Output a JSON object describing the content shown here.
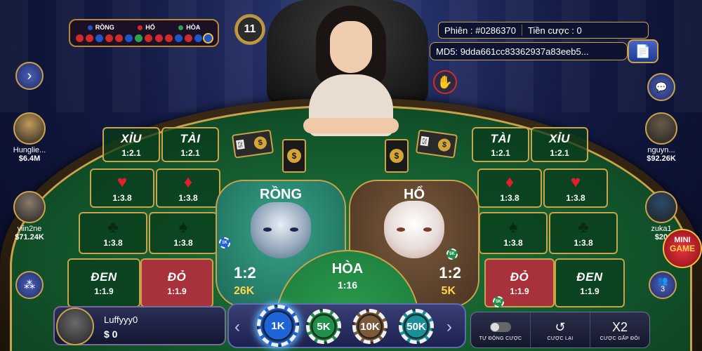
{
  "history": {
    "legend": [
      {
        "label": "RỒNG",
        "color": "#1e56c9"
      },
      {
        "label": "HỔ",
        "color": "#d12a2a"
      },
      {
        "label": "HÒA",
        "color": "#2aa34a"
      }
    ],
    "dots": [
      "#d12a2a",
      "#d12a2a",
      "#1e56c9",
      "#d12a2a",
      "#d12a2a",
      "#1e56c9",
      "#2aa34a",
      "#d12a2a",
      "#d12a2a",
      "#d12a2a",
      "#1e56c9",
      "#d12a2a",
      "#1e56c9",
      "#1e56c9"
    ]
  },
  "round_timer": "11",
  "session": {
    "phien_label": "Phiên :",
    "phien_value": "#0286370",
    "tien_label": "Tiền cược :",
    "tien_value": "0",
    "md5_label": "MD5:",
    "md5_value": "9dda661cc83362937a83eeb5..."
  },
  "players_left": [
    {
      "name": "Hunglie...",
      "amount": "$6.4M",
      "avatar_color": "#c49a5a"
    },
    {
      "name": "viin2ne",
      "amount": "$71.24K",
      "avatar_color": "#8a7a6a"
    }
  ],
  "players_right": [
    {
      "name": "nguyn...",
      "amount": "$92.26K",
      "avatar_color": "#6a5a4a"
    },
    {
      "name": "zuka1",
      "amount": "$20",
      "avatar_color": "#2a4a6a"
    }
  ],
  "left_cells": {
    "xiu": {
      "label": "XỈU",
      "odds": "1:2.1"
    },
    "tai": {
      "label": "TÀI",
      "odds": "1:2.1"
    },
    "heart": {
      "symbol": "♥",
      "odds": "1:3.8"
    },
    "diamond": {
      "symbol": "♦",
      "odds": "1:3.8"
    },
    "club": {
      "symbol": "♣",
      "odds": "1:3.8"
    },
    "spade": {
      "symbol": "♠",
      "odds": "1:3.8"
    },
    "den": {
      "label": "ĐEN",
      "odds": "1:1.9"
    },
    "do": {
      "label": "ĐỎ",
      "odds": "1:1.9"
    }
  },
  "right_cells": {
    "tai": {
      "label": "TÀI",
      "odds": "1:2.1"
    },
    "xiu": {
      "label": "XỈU",
      "odds": "1:2.1"
    },
    "diamond": {
      "symbol": "♦",
      "odds": "1:3.8"
    },
    "heart": {
      "symbol": "♥",
      "odds": "1:3.8"
    },
    "spade": {
      "symbol": "♠",
      "odds": "1:3.8"
    },
    "club": {
      "symbol": "♣",
      "odds": "1:3.8"
    },
    "do": {
      "label": "ĐỎ",
      "odds": "1:1.9"
    },
    "den": {
      "label": "ĐEN",
      "odds": "1:1.9"
    }
  },
  "zones": {
    "rong": {
      "title": "RỒNG",
      "odds": "1:2",
      "bet": "26K"
    },
    "ho": {
      "title": "HỔ",
      "odds": "1:2",
      "bet": "5K"
    },
    "hoa": {
      "title": "HÒA",
      "odds": "1:16"
    }
  },
  "cards": {
    "shoe_label": "52",
    "card_mark": "$"
  },
  "mini_chips": {
    "rong": "1K",
    "ho": "5K",
    "do": "5K"
  },
  "user": {
    "name": "Luffyyy0",
    "balance": "$ 0"
  },
  "chips": [
    {
      "label": "1K",
      "color": "#1f63d8",
      "selected": true
    },
    {
      "label": "5K",
      "color": "#1f8f4a",
      "selected": false
    },
    {
      "label": "10K",
      "color": "#7a5a3a",
      "selected": false
    },
    {
      "label": "50K",
      "color": "#1a8f9a",
      "selected": false
    }
  ],
  "controls": {
    "auto_label": "TỰ ĐỘNG CƯỢC",
    "rebet_label": "CƯỢC LẠI",
    "double_icon": "X2",
    "double_label": "CƯỢC GẤP ĐÔI"
  },
  "online_count": "3",
  "mini_game": {
    "line1": "MINI",
    "line2": "GAME"
  }
}
